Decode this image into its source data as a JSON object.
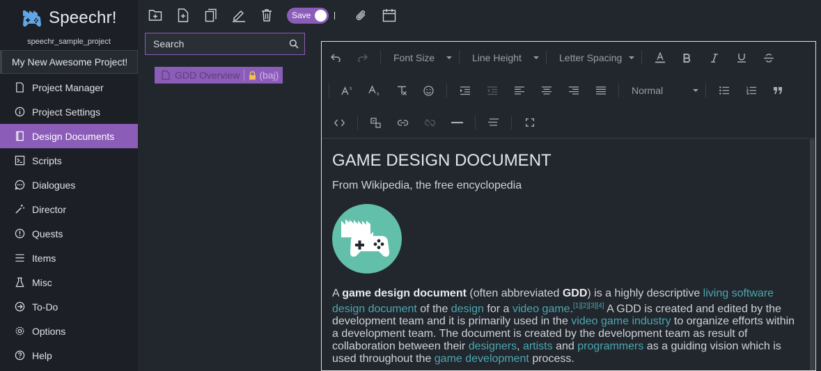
{
  "app": {
    "title": "Speechr!",
    "project_id": "speechr_sample_project",
    "project_name": "My New Awesome Project!"
  },
  "sidebar": {
    "items": [
      {
        "label": "Project Manager",
        "icon": "file-icon"
      },
      {
        "label": "Project Settings",
        "icon": "info-icon"
      },
      {
        "label": "Design Documents",
        "icon": "book-icon",
        "active": true
      },
      {
        "label": "Scripts",
        "icon": "terminal-icon"
      },
      {
        "label": "Dialogues",
        "icon": "chat-icon"
      },
      {
        "label": "Director",
        "icon": "wand-icon"
      },
      {
        "label": "Quests",
        "icon": "alert-icon"
      },
      {
        "label": "Items",
        "icon": "list-icon"
      },
      {
        "label": "Misc",
        "icon": "flask-icon"
      },
      {
        "label": "To-Do",
        "icon": "todo-icon"
      },
      {
        "label": "Options",
        "icon": "gear-icon"
      },
      {
        "label": "Help",
        "icon": "help-icon"
      }
    ]
  },
  "toolbar": {
    "save_label": "Save",
    "save_toggle_on": true
  },
  "search": {
    "placeholder": "Search"
  },
  "doc_chip": {
    "name": "GDD Overview",
    "owner": "(baj)"
  },
  "editor": {
    "font_size_label": "Font Size",
    "line_height_label": "Line Height",
    "letter_spacing_label": "Letter Spacing",
    "block_format_label": "Normal"
  },
  "document": {
    "title": "GAME DESIGN DOCUMENT",
    "subtitle": "From Wikipedia, the free encyclopedia",
    "p_1": " A ",
    "p_term": "game design document",
    "p_2": " (often abbreviated ",
    "p_abbr": "GDD",
    "p_3": ") is a highly descriptive ",
    "link_1": "living software design document",
    "p_4": " of the ",
    "link_2": "design",
    "p_5": " for a ",
    "link_3": "video game",
    "p_6": ".",
    "refs": "[1][2][3][4]",
    "p_7": "  A GDD is created and edited by the development team and it is primarily used in the ",
    "link_4": "video game industry",
    "p_8": "  to organize efforts within a development team.  The document is created  by the development team as result of collaboration between their ",
    "link_5": "designers",
    "p_9": ", ",
    "link_6": "artists",
    "p_10": " and ",
    "link_7": "programmers",
    "p_11": " as a guiding vision which is used throughout the ",
    "link_8": "game development",
    "p_12": "  process."
  },
  "colors": {
    "accent": "#8b5db8",
    "link": "#4ba8b0",
    "sidebar_bg": "#1c1f25",
    "main_bg": "#22262d",
    "hero_bg": "#62c0aa"
  }
}
